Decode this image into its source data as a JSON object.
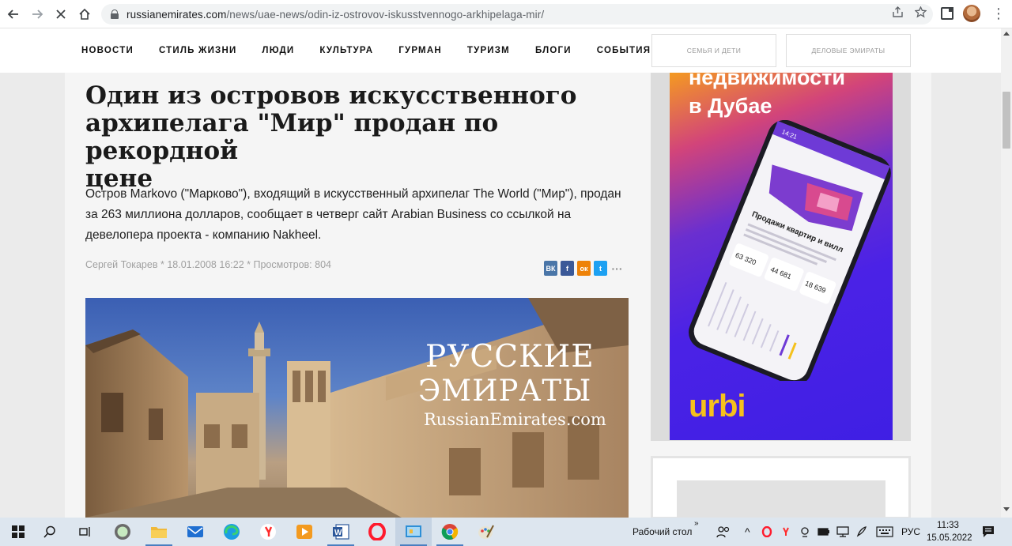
{
  "browser": {
    "url_domain": "russianemirates.com",
    "url_path": "/news/uae-news/odin-iz-ostrovov-iskusstvennogo-arkhipelaga-mir/"
  },
  "nav": {
    "items": [
      "НОВОСТИ",
      "СТИЛЬ ЖИЗНИ",
      "ЛЮДИ",
      "КУЛЬТУРА",
      "ГУРМАН",
      "ТУРИЗМ",
      "БЛОГИ",
      "СОБЫТИЯ"
    ],
    "family_button": "СЕМЬЯ И ДЕТИ",
    "business_button": "ДЕЛОВЫЕ ЭМИРАТЫ"
  },
  "article": {
    "title_line1": "Один из островов искусственного",
    "title_line2": "архипелага \"Мир\" продан по рекордной",
    "title_line3": "цене",
    "lead": "Остров Markovo (\"Марково\"), входящий в искусственный архипелаг The World (\"Мир\"), продан за 263 миллиона долларов, сообщает в четверг сайт Arabian Business со ссылкой на девелопера проекта - компанию Nakheel.",
    "author": "Сергей Токарев",
    "date": "18.01.2008 16:22",
    "views": "Просмотров: 804",
    "sep": "*"
  },
  "share": {
    "vk": "ВК",
    "fb": "f",
    "ok": "ок",
    "tw": "t",
    "more": "···"
  },
  "hero": {
    "brand_line1": "РУССКИЕ",
    "brand_line2": "ЭМИРАТЫ",
    "brand_line3": "RussianEmirates.com"
  },
  "ad": {
    "headline_1": "недвижимости",
    "headline_2": "в Дубае",
    "logo": "urbi",
    "phone_title": "Продажи квартир и вилл",
    "phone_stat1": "63 320",
    "phone_stat2": "44 681",
    "phone_stat3": "18 639",
    "phone_time": "14:21"
  },
  "taskbar": {
    "desktop_label": "Рабочий стол",
    "lang": "РУС",
    "time": "11:33",
    "date": "15.05.2022"
  },
  "colors": {
    "vk": "#4a76a8",
    "facebook": "#3b5998",
    "odnoklassniki": "#ee8208",
    "twitter": "#1da1f2",
    "urbi_yellow": "#f6c11c",
    "ad_purple": "#4b22e6"
  }
}
